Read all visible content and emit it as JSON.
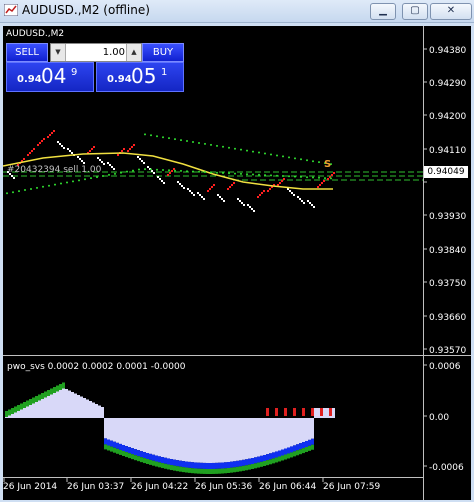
{
  "window": {
    "title": "AUDUSD.,M2 (offline)",
    "controls": [
      "minimize",
      "restore",
      "close"
    ]
  },
  "chart": {
    "symbol_label": "AUDUSD.,M2",
    "price_axis": [
      "0.94380",
      "0.94290",
      "0.94200",
      "0.94110",
      "0.93930",
      "0.93840",
      "0.93750",
      "0.93660",
      "0.93570"
    ],
    "current_price": "0.94049",
    "time_axis": [
      "26 Jun 2014",
      "26 Jun 03:37",
      "26 Jun 04:22",
      "26 Jun 05:36",
      "26 Jun 06:44",
      "26 Jun 07:59"
    ],
    "order_label": "#20432394 sell 1.00",
    "signal_marker": "S"
  },
  "trade_panel": {
    "sell_label": "SELL",
    "buy_label": "BUY",
    "lot_value": "1.00",
    "bid": {
      "prefix": "0.94",
      "big": "04",
      "sup": "9"
    },
    "ask": {
      "prefix": "0.94",
      "big": "05",
      "sup": "1"
    }
  },
  "indicator": {
    "label": "pwo_svs 0.0002 0.0002 0.0001 -0.0000",
    "axis": [
      "0.0006",
      "0.00",
      "-0.0006"
    ]
  },
  "colors": {
    "background": "#000000",
    "bull_candle": "#ff2020",
    "bear_candle": "#ffffff",
    "ma_line": "#f0e040",
    "envelope_dots": "#30e030",
    "buttons": "#1a2fe0"
  }
}
